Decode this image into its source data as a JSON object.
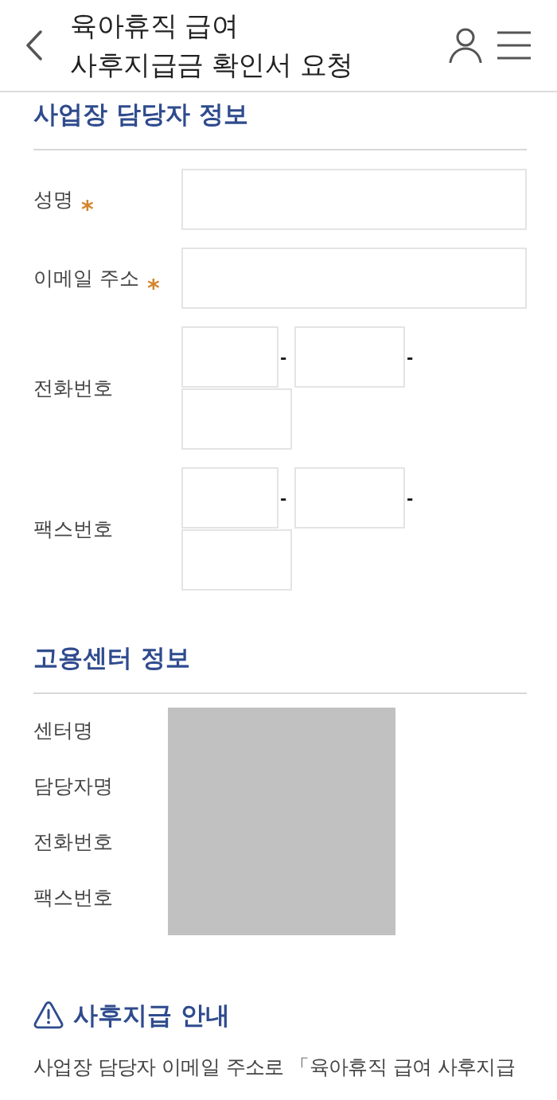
{
  "header": {
    "title_lines": [
      "육아휴직 급여",
      "사후지급금 확인서 요청"
    ]
  },
  "contact_section": {
    "title": "사업장 담당자 정보",
    "required_mark": "*",
    "fields": [
      {
        "kind": "text",
        "label": "성명",
        "required": true
      },
      {
        "kind": "text",
        "label": "이메일 주소",
        "required": true
      },
      {
        "kind": "split",
        "label": "전화번호",
        "required": false,
        "separators": [
          "-",
          "-"
        ]
      },
      {
        "kind": "split",
        "label": "팩스번호",
        "required": false,
        "separators": [
          "-",
          "-"
        ]
      }
    ]
  },
  "center_section": {
    "title": "고용센터 정보",
    "labels": [
      "센터명",
      "담당자명",
      "전화번호",
      "팩스번호"
    ],
    "redacted": true
  },
  "notice": {
    "title": "사후지급 안내",
    "text": "사업장 담당자 이메일 주소로 「육아휴직 급여 사후지급"
  }
}
